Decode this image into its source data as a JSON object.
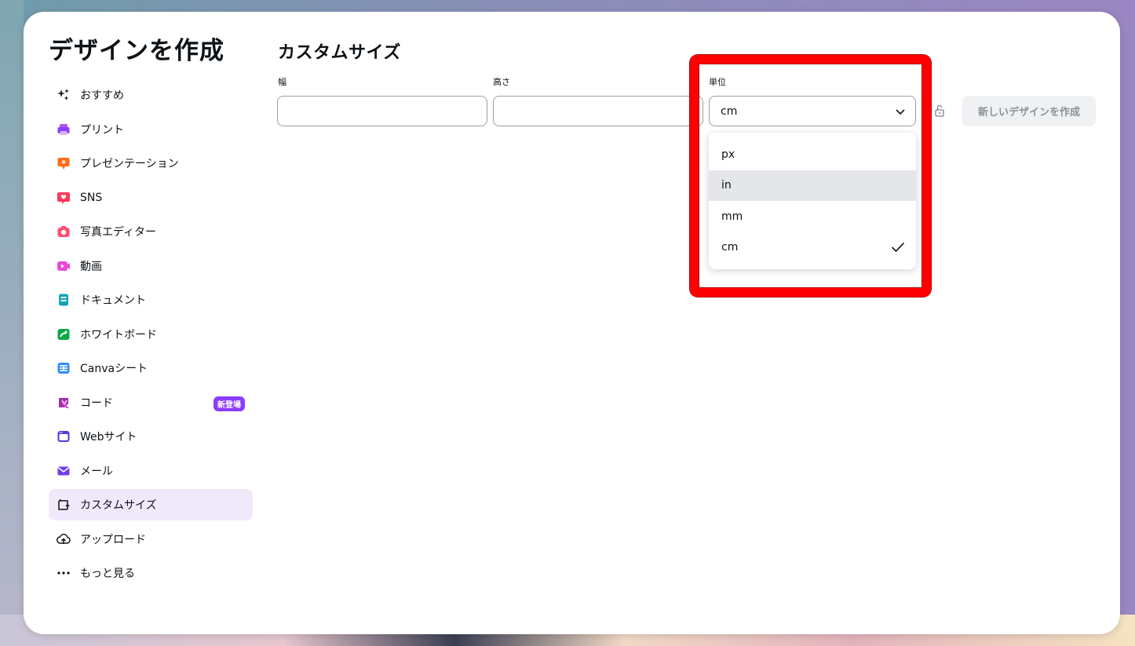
{
  "page_title": "デザインを作成",
  "nav": {
    "items": [
      {
        "label": "おすすめ",
        "icon": "sparkle-icon"
      },
      {
        "label": "プリント",
        "icon": "printer-icon"
      },
      {
        "label": "プレゼンテーション",
        "icon": "presentation-icon"
      },
      {
        "label": "SNS",
        "icon": "heart-chat-icon"
      },
      {
        "label": "写真エディター",
        "icon": "camera-icon"
      },
      {
        "label": "動画",
        "icon": "video-icon"
      },
      {
        "label": "ドキュメント",
        "icon": "document-icon"
      },
      {
        "label": "ホワイトボード",
        "icon": "whiteboard-icon"
      },
      {
        "label": "Canvaシート",
        "icon": "sheet-icon"
      },
      {
        "label": "コード",
        "icon": "code-icon",
        "badge": "新登場"
      },
      {
        "label": "Webサイト",
        "icon": "website-icon"
      },
      {
        "label": "メール",
        "icon": "mail-icon"
      },
      {
        "label": "カスタムサイズ",
        "icon": "custom-size-icon",
        "active": true
      },
      {
        "label": "アップロード",
        "icon": "upload-icon"
      },
      {
        "label": "もっと見る",
        "icon": "more-icon"
      }
    ]
  },
  "custom": {
    "title": "カスタムサイズ",
    "width_label": "幅",
    "width_value": "",
    "height_label": "高さ",
    "height_value": "",
    "unit_label": "単位",
    "unit_selected": "cm",
    "unit_options": [
      "px",
      "in",
      "mm",
      "cm"
    ],
    "hovered_option": "in",
    "create_button": "新しいデザインを作成"
  },
  "colors": {
    "accent": "#8b3dff",
    "highlight": "#ff0000",
    "active_bg": "#efe9fb"
  }
}
